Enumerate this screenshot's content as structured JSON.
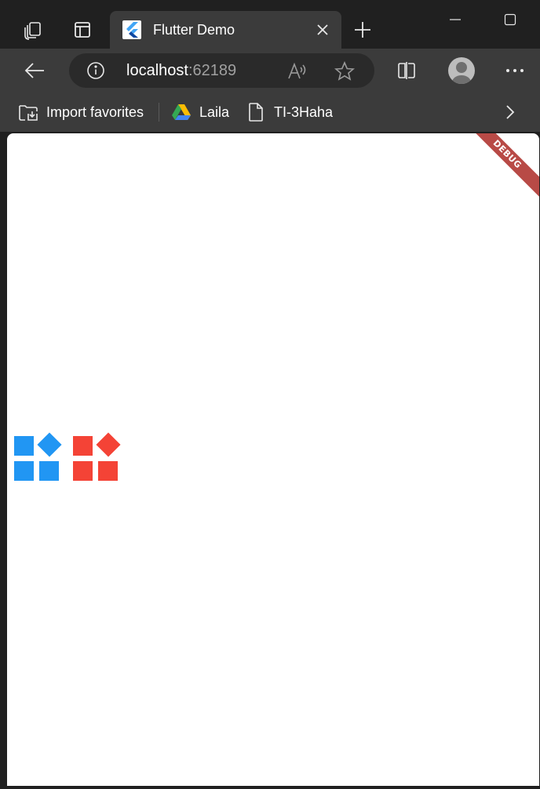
{
  "browser": {
    "tab": {
      "title": "Flutter Demo"
    },
    "address": {
      "host": "localhost",
      "port": ":62189"
    },
    "favorites": [
      {
        "label": "Import favorites",
        "icon": "import-favorites-icon"
      },
      {
        "label": "Laila",
        "icon": "google-drive-icon"
      },
      {
        "label": "TI-3Haha",
        "icon": "page-icon"
      }
    ],
    "colors": {
      "frame": "#202020",
      "toolbar": "#3b3b3b",
      "omnibox": "#2a2a2a",
      "icon": "#e8e8e8"
    }
  },
  "app": {
    "debug_banner": "DEBUG",
    "icons": [
      {
        "name": "widgets-icon-blue",
        "color": "#2196f3"
      },
      {
        "name": "widgets-icon-red",
        "color": "#f44336"
      }
    ],
    "background": "#ffffff"
  }
}
